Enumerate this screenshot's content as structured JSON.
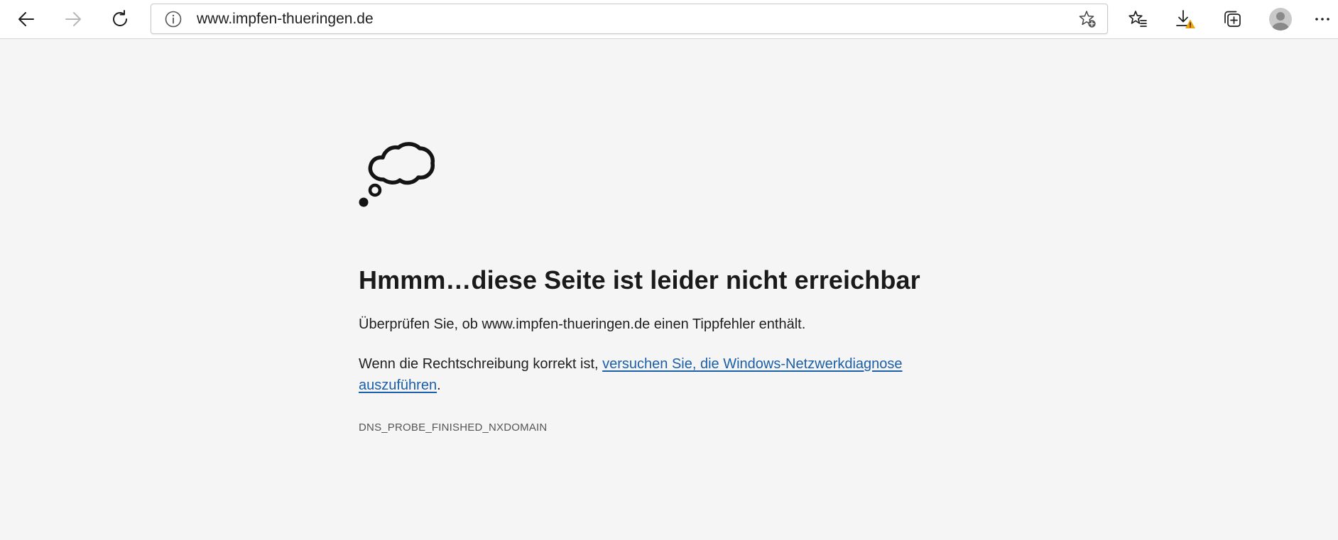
{
  "toolbar": {
    "back_icon": "arrow-left-icon",
    "forward_icon": "arrow-right-icon",
    "refresh_icon": "refresh-icon",
    "favorites_icon": "favorites-list-icon",
    "downloads_icon": "download-warning-icon",
    "collections_icon": "collections-icon",
    "profile_icon": "avatar-icon",
    "menu_icon": "more-horizontal-icon"
  },
  "address_bar": {
    "url": "www.impfen-thueringen.de",
    "info_icon": "info-circle-icon",
    "favorite_icon": "star-add-icon"
  },
  "page": {
    "icon": "thought-cloud-icon",
    "headline": "Hmmm…diese Seite ist leider nicht erreichbar",
    "check_text": "Überprüfen Sie, ob www.impfen-thueringen.de einen Tippfehler enthält.",
    "spelling_text": "Wenn die Rechtschreibung korrekt ist, ",
    "diagnose_link": "versuchen Sie, die Windows-Netzwerkdiagnose auszuführen",
    "spelling_end": ".",
    "error_code": "DNS_PROBE_FINISHED_NXDOMAIN"
  },
  "colors": {
    "link": "#1a5fa8",
    "warning": "#f0a30a",
    "background": "#f5f5f5"
  }
}
